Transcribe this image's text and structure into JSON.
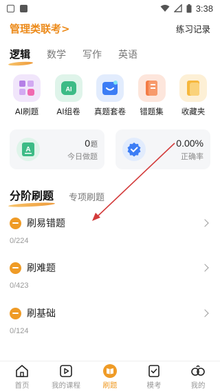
{
  "status_bar": {
    "time": "3:38"
  },
  "header": {
    "exam_title": "管理类联考>",
    "practice_record": "练习记录"
  },
  "subjects": [
    "逻辑",
    "数学",
    "写作",
    "英语"
  ],
  "active_subject": "逻辑",
  "features": [
    {
      "label": "AI刷题",
      "icon": "ai-quiz-icon",
      "color": "#b57fe6"
    },
    {
      "label": "AI组卷",
      "icon": "ai-paper-icon",
      "color": "#3dbb86"
    },
    {
      "label": "真题套卷",
      "icon": "past-exam-icon",
      "color": "#3c7df5"
    },
    {
      "label": "错题集",
      "icon": "wrong-book-icon",
      "color": "#f47c45"
    },
    {
      "label": "收藏夹",
      "icon": "favorites-icon",
      "color": "#f6b73c"
    }
  ],
  "stats": {
    "today": {
      "value": "0",
      "unit": "题",
      "label": "今日做题"
    },
    "accuracy": {
      "value": "0.00%",
      "label": "正确率"
    }
  },
  "level_tabs": [
    "分阶刷题",
    "专项刷题"
  ],
  "levels": [
    {
      "name": "刷易错题",
      "progress": "0/224"
    },
    {
      "name": "刷难题",
      "progress": "0/423"
    },
    {
      "name": "刷基础",
      "progress": "0/124"
    }
  ],
  "tabbar": [
    {
      "label": "首页",
      "icon": "home-icon"
    },
    {
      "label": "我的课程",
      "icon": "course-play-icon"
    },
    {
      "label": "刷题",
      "icon": "quiz-book-icon",
      "active": true
    },
    {
      "label": "模考",
      "icon": "mock-exam-icon"
    },
    {
      "label": "我的",
      "icon": "profile-icon"
    }
  ],
  "colors": {
    "accent": "#ef9b26",
    "title_orange": "#ec8b1c",
    "annotation_arrow": "#d33b3b"
  }
}
